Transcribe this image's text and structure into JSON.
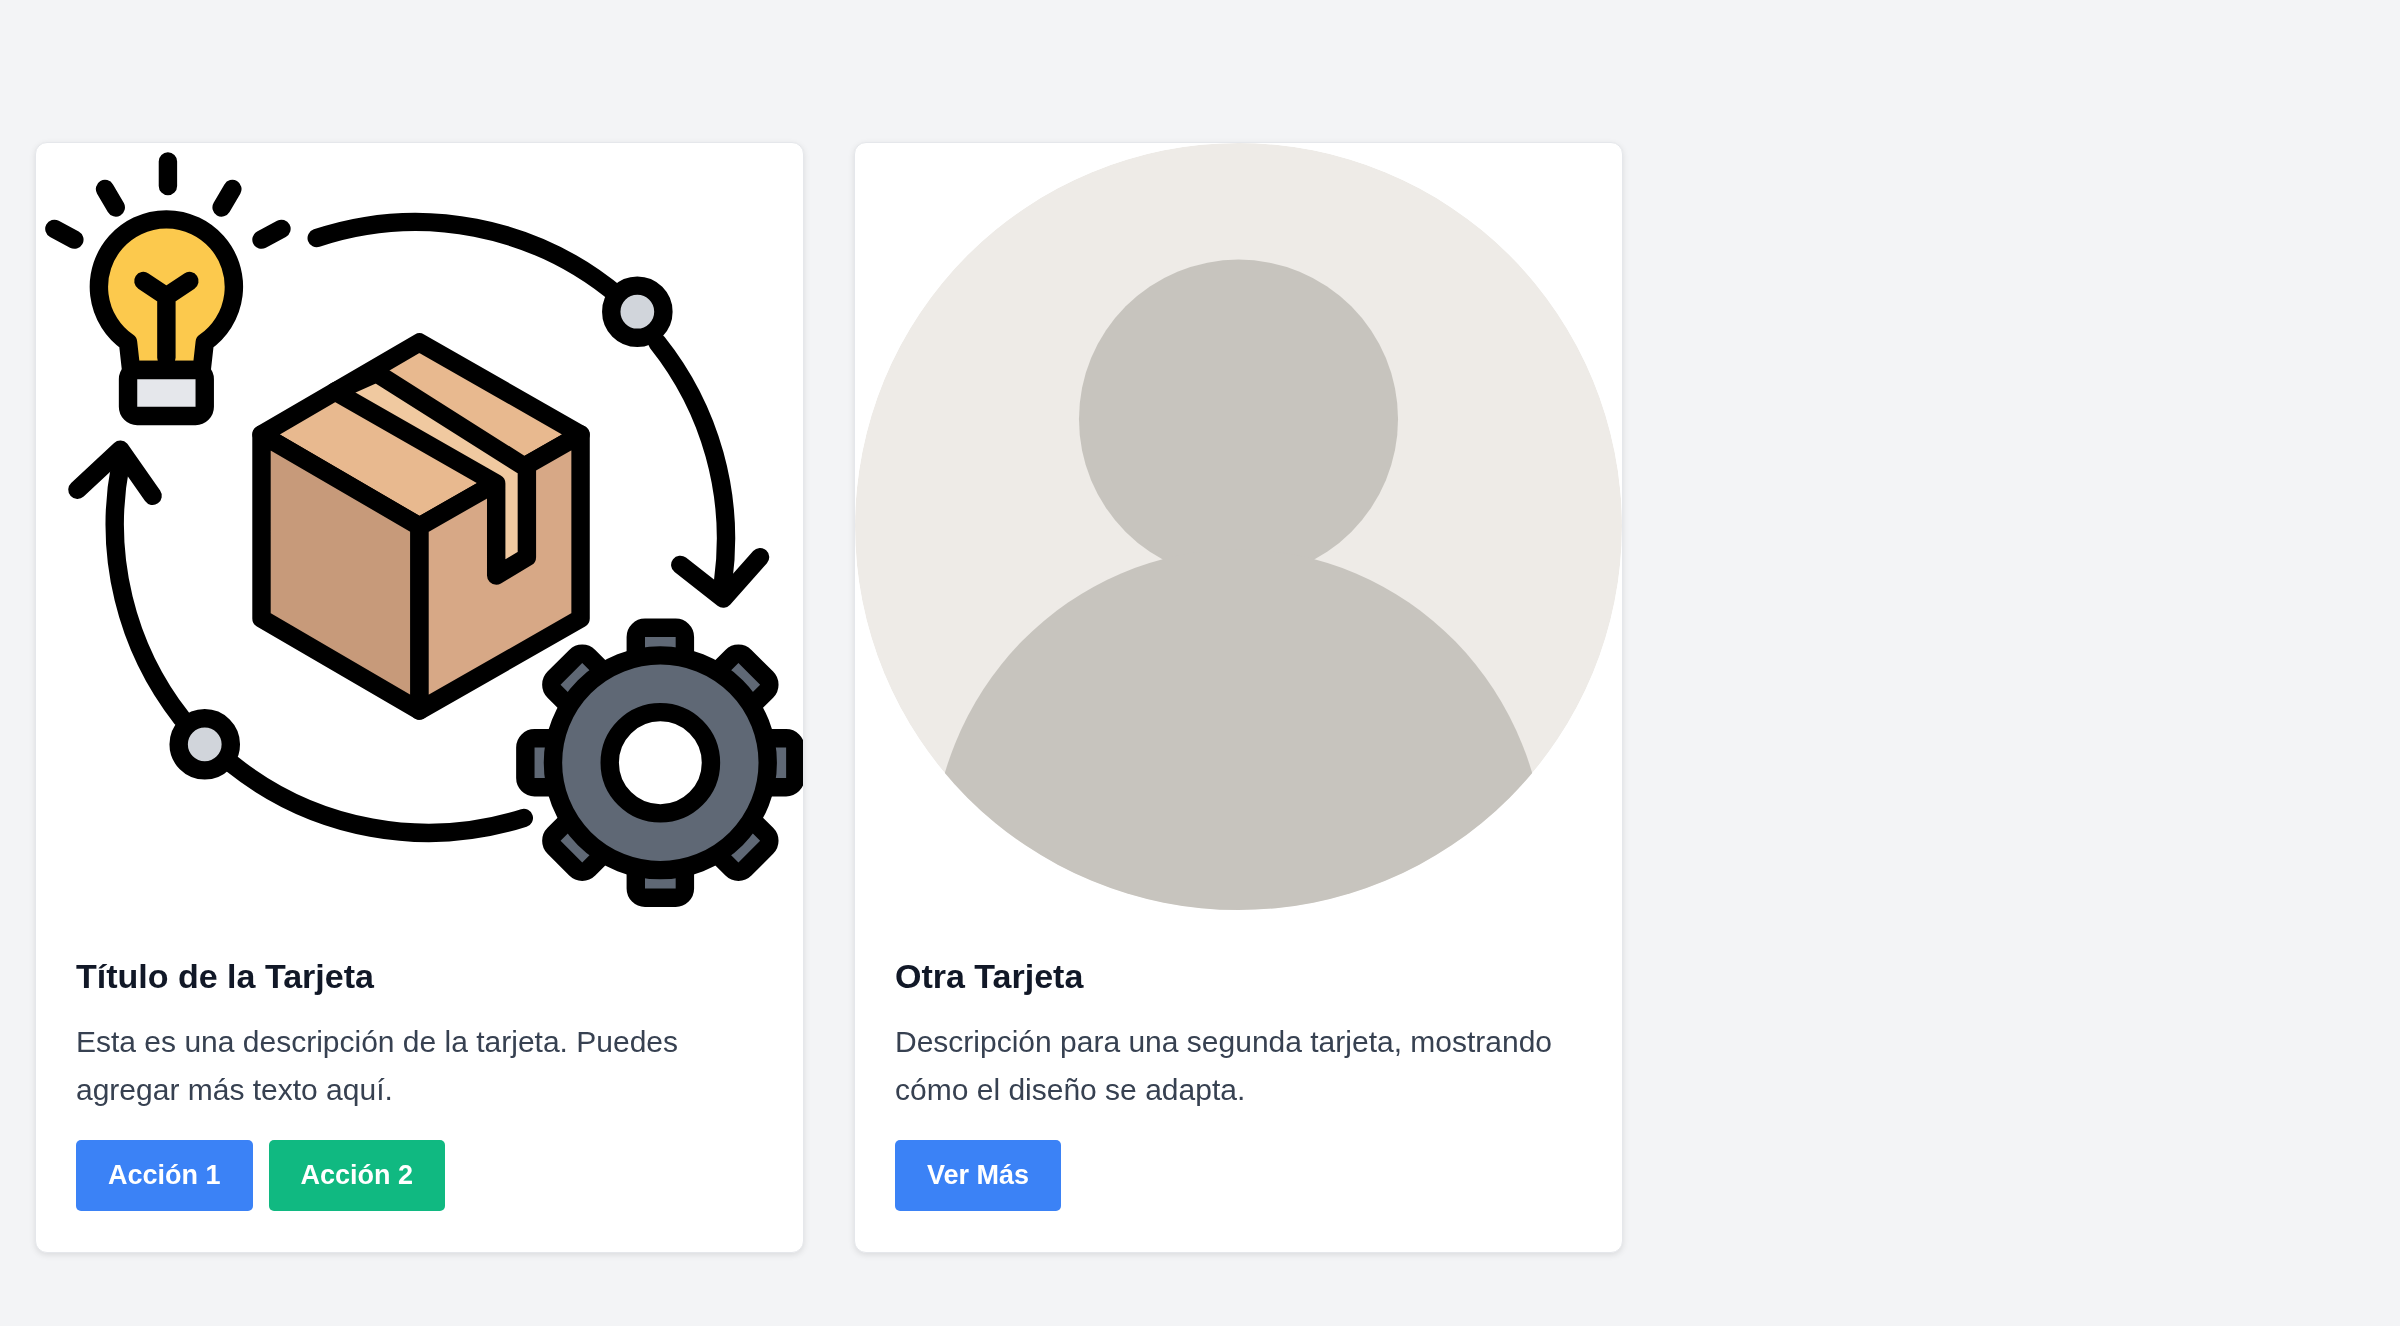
{
  "cards": [
    {
      "image": {
        "kind": "illustration"
      },
      "title": "Título de la Tarjeta",
      "description": "Esta es una descripción de la tarjeta. Puedes agregar más texto aquí.",
      "buttons": [
        {
          "label": "Acción 1",
          "color": "#3b82f6"
        },
        {
          "label": "Acción 2",
          "color": "#10b981"
        }
      ]
    },
    {
      "image": {
        "kind": "avatar"
      },
      "title": "Otra Tarjeta",
      "description": "Descripción para una segunda tarjeta, mostrando cómo el diseño se adapta.",
      "buttons": [
        {
          "label": "Ver Más",
          "color": "#3b82f6"
        }
      ]
    }
  ]
}
